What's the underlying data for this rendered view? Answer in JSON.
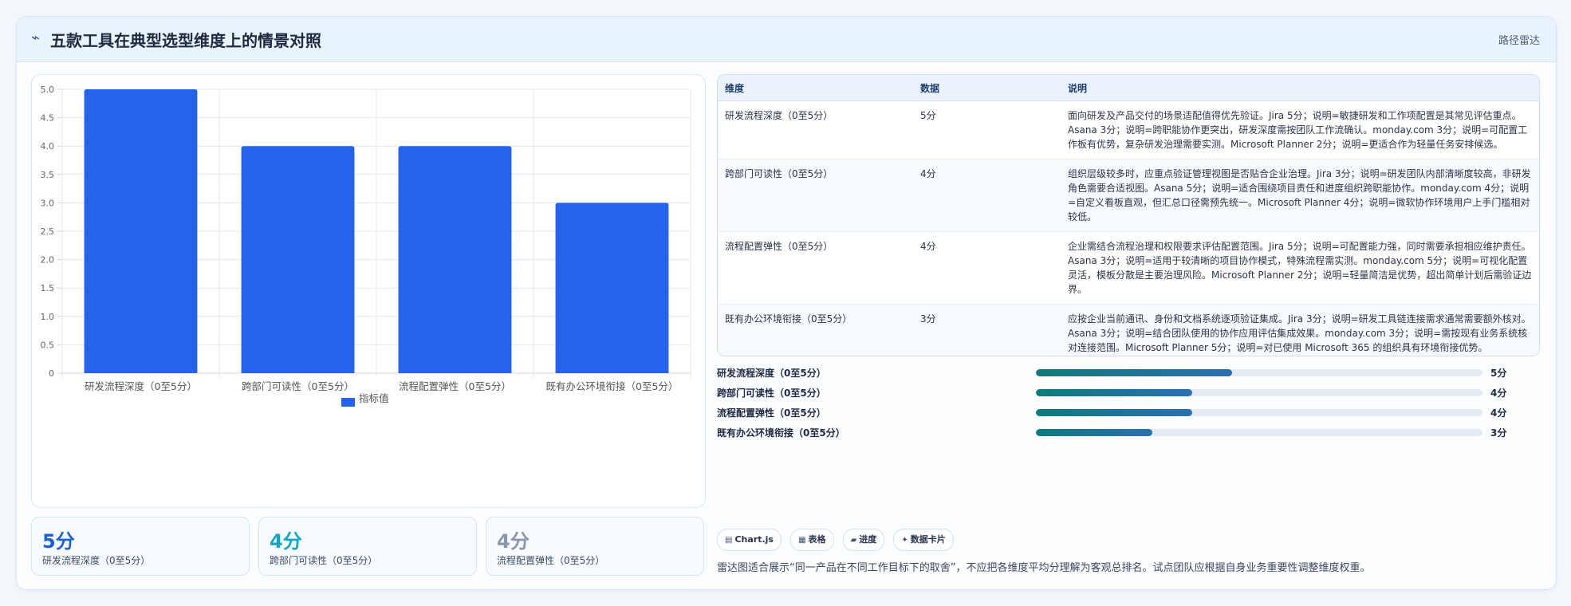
{
  "header": {
    "icon": "telescope-icon",
    "title": "五款工具在典型选型维度上的情景对照",
    "tag": "路径雷达"
  },
  "chart_data": {
    "type": "bar",
    "categories": [
      "研发流程深度（0至5分）",
      "跨部门可读性（0至5分）",
      "流程配置弹性（0至5分）",
      "既有办公环境衔接（0至5分）"
    ],
    "series": [
      {
        "name": "指标值",
        "values": [
          5,
          4,
          4,
          3
        ],
        "color": "#2563eb"
      }
    ],
    "ylim": [
      0,
      5
    ],
    "yticks": [
      "0",
      "0.5",
      "1.0",
      "1.5",
      "2.0",
      "2.5",
      "3.0",
      "3.5",
      "4.0",
      "4.5",
      "5.0"
    ],
    "grid": true,
    "legend": "bottom"
  },
  "stats": [
    {
      "value": "5分",
      "label": "研发流程深度（0至5分）",
      "color": "#1d5fd6"
    },
    {
      "value": "4分",
      "label": "跨部门可读性（0至5分）",
      "color": "#12a5c4"
    },
    {
      "value": "4分",
      "label": "流程配置弹性（0至5分）",
      "color": "#8a97ab"
    }
  ],
  "table": {
    "headers": [
      "维度",
      "数据",
      "说明"
    ],
    "rows": [
      {
        "dim": "研发流程深度（0至5分）",
        "data": "5分",
        "desc": "面向研发及产品交付的场景适配值得优先验证。Jira 5分；说明=敏捷研发和工作项配置是其常见评估重点。Asana 3分；说明=跨职能协作更突出，研发深度需按团队工作流确认。monday.com 3分；说明=可配置工作板有优势，复杂研发治理需要实测。Microsoft Planner 2分；说明=更适合作为轻量任务安排候选。"
      },
      {
        "dim": "跨部门可读性（0至5分）",
        "data": "4分",
        "desc": "组织层级较多时，应重点验证管理视图是否贴合企业治理。Jira 3分；说明=研发团队内部清晰度较高，非研发角色需要合适视图。Asana 5分；说明=适合围绕项目责任和进度组织跨职能协作。monday.com 4分；说明=自定义看板直观，但汇总口径需预先统一。Microsoft Planner 4分；说明=微软协作环境用户上手门槛相对较低。"
      },
      {
        "dim": "流程配置弹性（0至5分）",
        "data": "4分",
        "desc": "企业需结合流程治理和权限要求评估配置范围。Jira 5分；说明=可配置能力强，同时需要承担相应维护责任。Asana 3分；说明=适用于较清晰的项目协作模式，特殊流程需实测。monday.com 5分；说明=可视化配置灵活，模板分散是主要治理风险。Microsoft Planner 2分；说明=轻量简洁是优势，超出简单计划后需验证边界。"
      },
      {
        "dim": "既有办公环境衔接（0至5分）",
        "data": "3分",
        "desc": "应按企业当前通讯、身份和文档系统逐项验证集成。Jira 3分；说明=研发工具链连接需求通常需要额外核对。Asana 3分；说明=结合团队使用的协作应用评估集成效果。monday.com 3分；说明=需按现有业务系统核对连接范围。Microsoft Planner 5分；说明=对已使用 Microsoft 365 的组织具有环境衔接优势。"
      }
    ]
  },
  "progress": [
    {
      "label": "研发流程深度（0至5分）",
      "value": "5分",
      "fraction": 0.44
    },
    {
      "label": "跨部门可读性（0至5分）",
      "value": "4分",
      "fraction": 0.35
    },
    {
      "label": "流程配置弹性（0至5分）",
      "value": "4分",
      "fraction": 0.35
    },
    {
      "label": "既有办公环境衔接（0至5分）",
      "value": "3分",
      "fraction": 0.26
    }
  ],
  "chips": [
    {
      "icon": "chart-icon",
      "label": "Chart.js"
    },
    {
      "icon": "table-icon",
      "label": "表格"
    },
    {
      "icon": "progress-icon",
      "label": "进度"
    },
    {
      "icon": "sparkle-icon",
      "label": "数据卡片"
    }
  ],
  "note": "雷达图适合展示“同一产品在不同工作目标下的取舍”，不应把各维度平均分理解为客观总排名。试点团队应根据自身业务重要性调整维度权重。"
}
